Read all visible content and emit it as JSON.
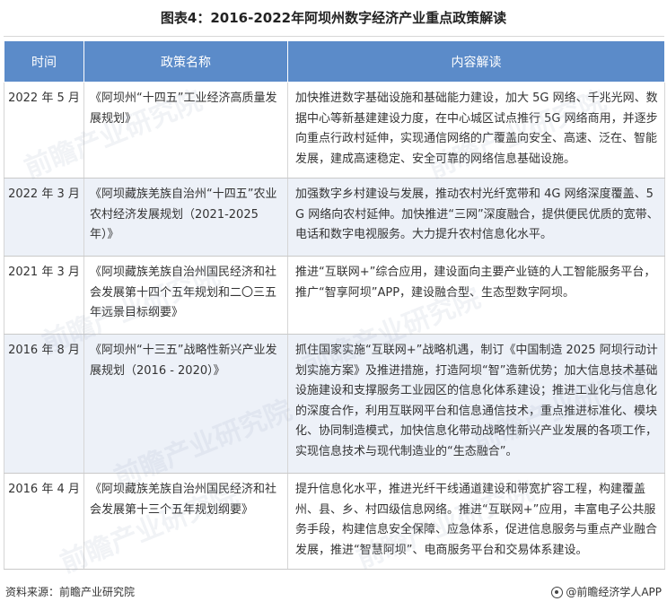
{
  "title": "图表4：2016-2022年阿坝州数字经济产业重点政策解读",
  "table": {
    "headers": [
      "时间",
      "政策名称",
      "内容解读"
    ],
    "rows": [
      {
        "date": "2022 年 5 月",
        "policy": "《阿坝州“十四五”工业经济高质量发展规划》",
        "content": "加快推进数字基础设施和基础能力建设，加大 5G 网络、千兆光网、数据中心等新基建建设力度，在中心城区试点推行 5G 网络商用，并逐步向重点行政村延伸，实现通信网络的广覆盖向安全、高速、泛在、智能发展，建成高速稳定、安全可靠的网络信息基础设施。"
      },
      {
        "date": "2022 年 3 月",
        "policy": "《阿坝藏族羌族自治州“十四五”农业农村经济发展规划（2021-2025 年）》",
        "content": "加强数字乡村建设与发展，推动农村光纤宽带和 4G 网络深度覆盖、5G 网络向农村延伸。加快推进“三网”深度融合，提供便民优质的宽带、电话和数字电视服务。大力提升农村信息化水平。"
      },
      {
        "date": "2021 年 3 月",
        "policy": "《阿坝藏族羌族自治州国民经济和社会发展第十四个五年规划和二〇三五年远景目标纲要》",
        "content": "推进“互联网+”综合应用，建设面向主要产业链的人工智能服务平台，推广“智享阿坝”APP，建设融合型、生态型数字阿坝。"
      },
      {
        "date": "2016 年 8 月",
        "policy": "《阿坝州“十三五”战略性新兴产业发展规划（2016 - 2020）》",
        "content": "抓住国家实施“互联网+”战略机遇，制订《中国制造 2025 阿坝行动计划实施方案》及推进措施，打造阿坝“智”造新优势；加大信息技术基础设施建设和支撑服务工业园区的信息化体系建设；推进工业化与信息化的深度合作，利用互联网平台和信息通信技术，重点推进标准化、模块化、协同制造模式，加快信息化带动战略性新兴产业发展的各项工作，实现信息技术与现代制造业的“生态融合”。"
      },
      {
        "date": "2016 年 4 月",
        "policy": "《阿坝藏族羌族自治州国民经济和社会发展第十三个五年规划纲要》",
        "content": "提升信息化水平，推进光纤干线通道建设和带宽扩容工程，构建覆盖州、县、乡、村四级信息网络。推进“互联网+”应用，丰富电子公共服务手段，构建信息安全保障、应急体系，促进信息服务与重点产业融合发展，推进“智慧阿坝”、电商服务平台和交易体系建设。"
      }
    ]
  },
  "footer": {
    "source": "资料来源：前瞻产业研究院",
    "brand": "@前瞻经济学人APP"
  },
  "watermark": "前瞻产业研究院"
}
